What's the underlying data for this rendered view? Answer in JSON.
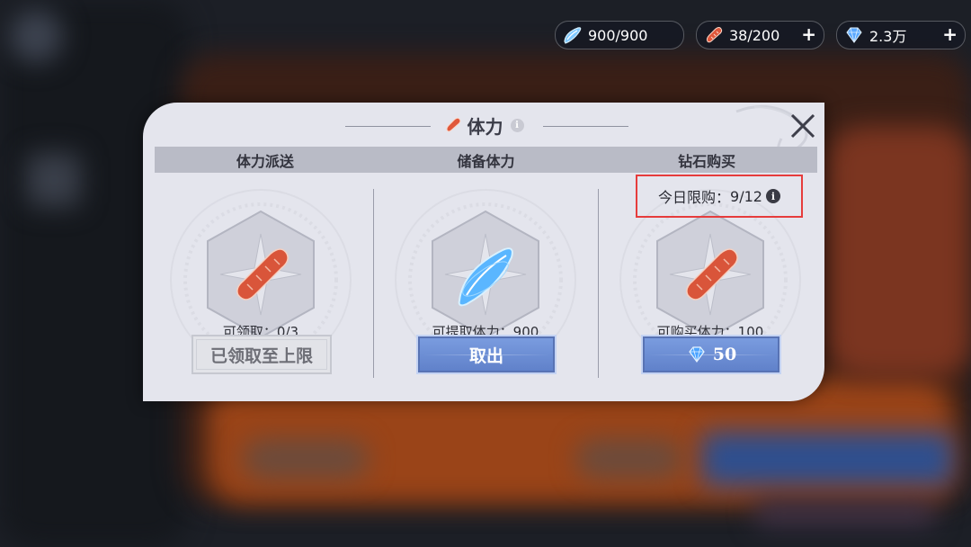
{
  "resources": [
    {
      "icon": "stamina-crystal-icon",
      "value": "900/900"
    },
    {
      "icon": "sausage-icon",
      "value": "38/200",
      "plus": "+"
    },
    {
      "icon": "diamond-icon",
      "value": "2.3万",
      "plus": "+"
    }
  ],
  "dialog": {
    "title": "体力",
    "close_icon": "close-icon",
    "headers": [
      "体力派送",
      "储备体力",
      "钻石购买"
    ],
    "columns": [
      {
        "item_icon": "sausage-icon",
        "label": "可领取：0/3",
        "button": "已领取至上限",
        "button_state": "disabled"
      },
      {
        "item_icon": "stamina-crystal-icon",
        "label": "可提取体力：900",
        "button": "取出",
        "button_state": "active"
      },
      {
        "item_icon": "sausage-icon",
        "label": "可购买体力：100",
        "button_icon": "diamond-icon",
        "button": "50",
        "button_state": "active"
      }
    ],
    "purchase_limit": {
      "label": "今日限购：",
      "value": "9/12",
      "info_icon": "info-icon"
    }
  },
  "colors": {
    "dialog_bg": "#e4e5ed",
    "header_bg": "#b9bbc6",
    "button_blue": "#6c8dd5",
    "highlight_red": "#e63c3c"
  }
}
